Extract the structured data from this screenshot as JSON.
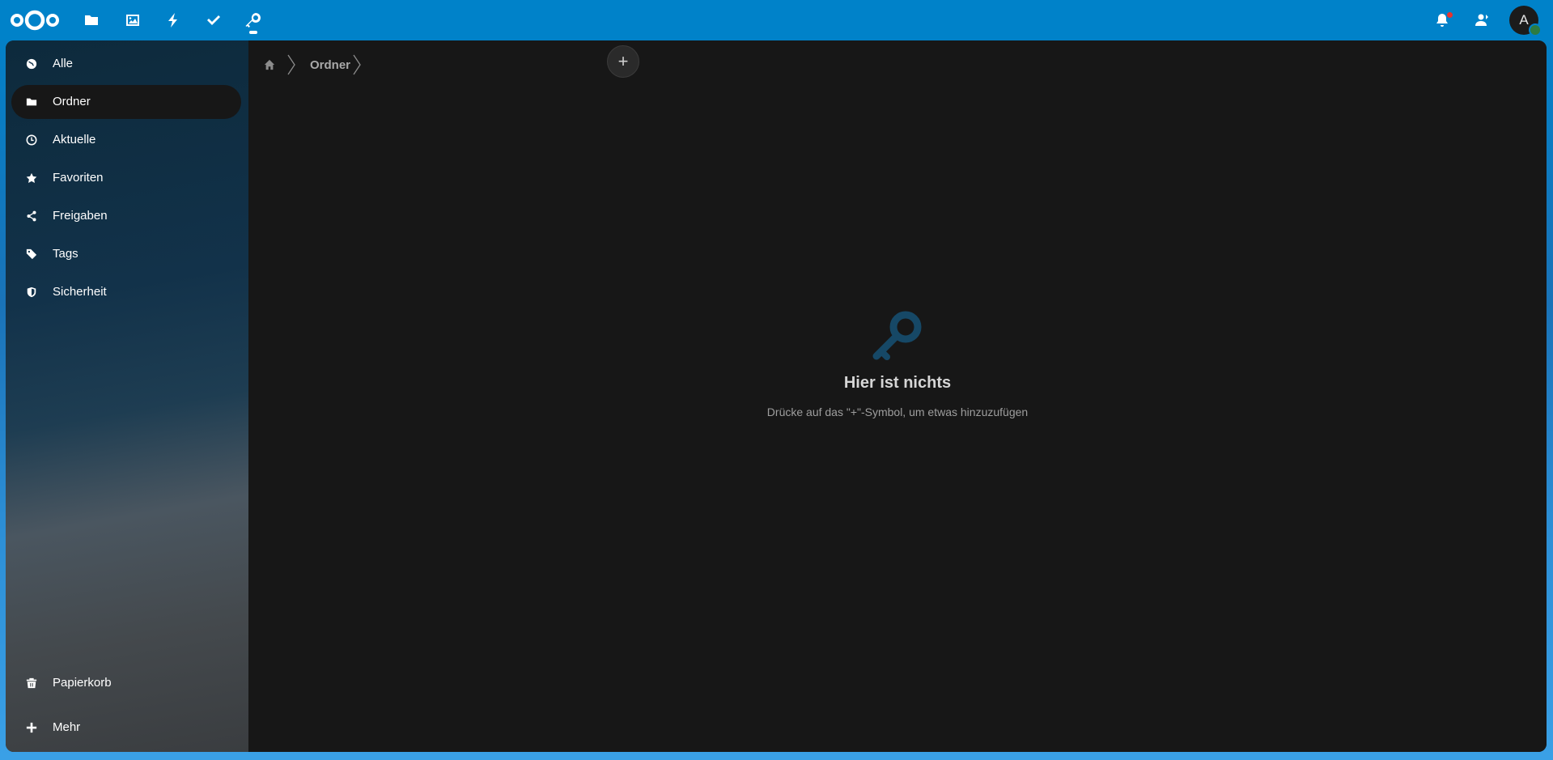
{
  "header": {
    "logo_icon": "nextcloud-logo-icon",
    "apps": [
      {
        "name": "files-icon"
      },
      {
        "name": "photos-icon"
      },
      {
        "name": "activity-icon"
      },
      {
        "name": "tasks-icon"
      },
      {
        "name": "passwords-icon",
        "active": true
      }
    ],
    "notifications_icon": "bell-icon",
    "contacts_icon": "contacts-icon",
    "avatar_initial": "A",
    "colors": {
      "primary": "#0082c9",
      "status_online": "#2d7b41",
      "notif": "#e9322d"
    }
  },
  "sidebar": {
    "items": [
      {
        "label": "Alle",
        "icon": "globe-icon"
      },
      {
        "label": "Ordner",
        "icon": "folder-icon",
        "active": true
      },
      {
        "label": "Aktuelle",
        "icon": "clock-icon"
      },
      {
        "label": "Favoriten",
        "icon": "star-icon"
      },
      {
        "label": "Freigaben",
        "icon": "share-icon"
      },
      {
        "label": "Tags",
        "icon": "tag-icon"
      },
      {
        "label": "Sicherheit",
        "icon": "shield-icon"
      }
    ],
    "bottom": [
      {
        "label": "Papierkorb",
        "icon": "trash-icon"
      },
      {
        "label": "Mehr",
        "icon": "plus-icon"
      }
    ]
  },
  "breadcrumb": {
    "home_icon": "home-icon",
    "current": "Ordner",
    "add_label": "+"
  },
  "empty_state": {
    "icon": "key-icon",
    "title": "Hier ist nichts",
    "subtitle": "Drücke auf das \"+\"-Symbol, um etwas hinzuzufügen"
  }
}
